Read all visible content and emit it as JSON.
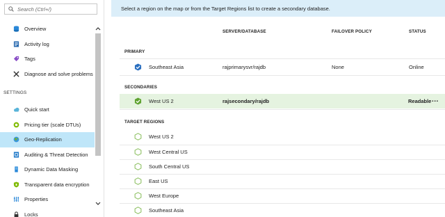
{
  "search": {
    "placeholder": "Search (Ctrl+/)"
  },
  "sidebar": {
    "items": [
      {
        "label": "Overview",
        "icon": "database-icon"
      },
      {
        "label": "Activity log",
        "icon": "activity-log-icon"
      },
      {
        "label": "Tags",
        "icon": "tag-icon"
      },
      {
        "label": "Diagnose and solve problems",
        "icon": "wrench-icon"
      }
    ],
    "settings_label": "SETTINGS",
    "settings_items": [
      {
        "label": "Quick start",
        "icon": "cloud-icon"
      },
      {
        "label": "Pricing tier (scale DTUs)",
        "icon": "pricing-icon"
      },
      {
        "label": "Geo-Replication",
        "icon": "globe-icon",
        "selected": true
      },
      {
        "label": "Auditing & Threat Detection",
        "icon": "auditing-icon"
      },
      {
        "label": "Dynamic Data Masking",
        "icon": "masking-icon"
      },
      {
        "label": "Transparent data encryption",
        "icon": "shield-icon"
      },
      {
        "label": "Properties",
        "icon": "properties-icon"
      },
      {
        "label": "Locks",
        "icon": "lock-icon"
      }
    ]
  },
  "main": {
    "info": "Select a region on the map or from the Target Regions list to create a secondary database.",
    "columns": {
      "server": "SERVER/DATABASE",
      "policy": "FAILOVER POLICY",
      "status": "STATUS"
    },
    "primary_label": "PRIMARY",
    "primary": {
      "name": "Southeast Asia",
      "server": "rajprimarysvr/rajdb",
      "policy": "None",
      "status": "Online"
    },
    "secondaries_label": "SECONDARIES",
    "secondary": {
      "name": "West US 2",
      "server": "rajsecondary/rajdb",
      "status": "Readable",
      "more": "..."
    },
    "target_label": "TARGET REGIONS",
    "targets": [
      "West US 2",
      "West Central US",
      "South Central US",
      "East US",
      "West Europe",
      "Southeast Asia"
    ]
  },
  "colors": {
    "accent": "#0072c6",
    "selected_nav": "#bfe6f9",
    "info_bar": "#dbeef9",
    "secondary_row": "#e5f3e0",
    "hexagon": "#7ab648"
  }
}
